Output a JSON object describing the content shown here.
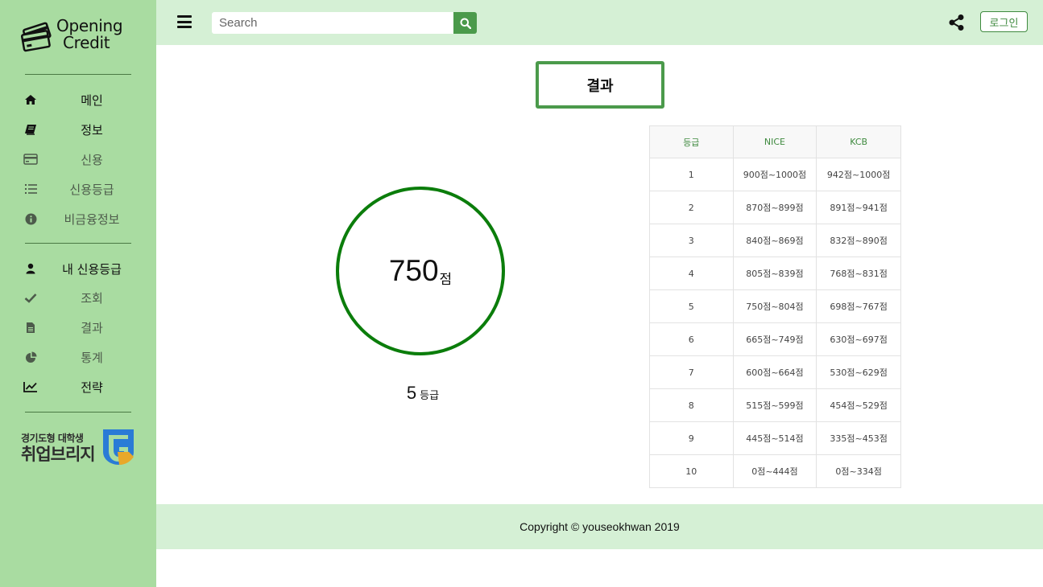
{
  "brand": {
    "line1": "Opening",
    "line2": "Credit"
  },
  "sidebar": {
    "group1": [
      {
        "label": "메인",
        "icon": "home-icon"
      },
      {
        "label": "정보",
        "icon": "book-icon"
      },
      {
        "label": "신용",
        "icon": "credit-card-icon"
      },
      {
        "label": "신용등급",
        "icon": "list-icon"
      },
      {
        "label": "비금융정보",
        "icon": "info-circle-icon"
      }
    ],
    "group2": [
      {
        "label": "내 신용등급",
        "icon": "user-icon"
      },
      {
        "label": "조회",
        "icon": "check-icon"
      },
      {
        "label": "결과",
        "icon": "file-icon"
      },
      {
        "label": "통계",
        "icon": "pie-chart-icon"
      },
      {
        "label": "전략",
        "icon": "line-chart-icon"
      }
    ],
    "partner": {
      "line1": "경기도형 대학생",
      "line2": "취업브리지"
    }
  },
  "header": {
    "search_placeholder": "Search",
    "login_label": "로그인"
  },
  "main": {
    "title": "결과",
    "score": "750",
    "score_unit": "점",
    "grade": "5",
    "grade_unit": "등급"
  },
  "table": {
    "headers": [
      "등급",
      "NICE",
      "KCB"
    ],
    "rows": [
      [
        "1",
        "900점~1000점",
        "942점~1000점"
      ],
      [
        "2",
        "870점~899점",
        "891점~941점"
      ],
      [
        "3",
        "840점~869점",
        "832점~890점"
      ],
      [
        "4",
        "805점~839점",
        "768점~831점"
      ],
      [
        "5",
        "750점~804점",
        "698점~767점"
      ],
      [
        "6",
        "665점~749점",
        "630점~697점"
      ],
      [
        "7",
        "600점~664점",
        "530점~629점"
      ],
      [
        "8",
        "515점~599점",
        "454점~529점"
      ],
      [
        "9",
        "445점~514점",
        "335점~453점"
      ],
      [
        "10",
        "0점~444점",
        "0점~334점"
      ]
    ]
  },
  "footer": {
    "copyright": "Copyright © youseokhwan 2019"
  },
  "colors": {
    "sidebar": "#a9dca1",
    "topbar": "#d5f0d5",
    "accent": "#4b9a4b",
    "circle": "#0b7d0b"
  }
}
